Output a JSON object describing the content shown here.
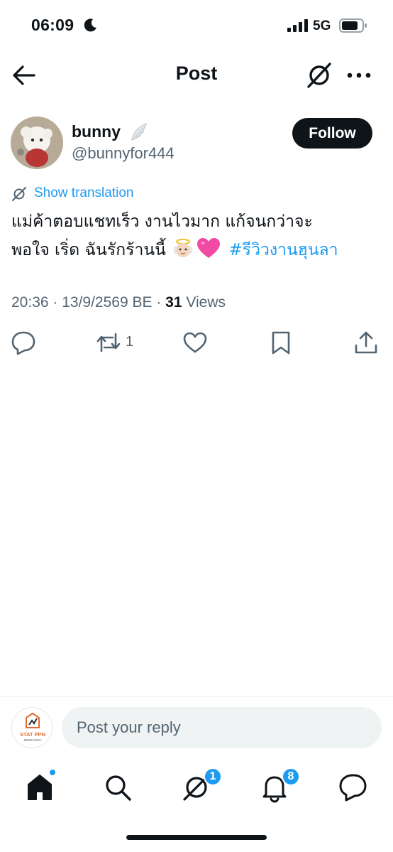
{
  "status_bar": {
    "time": "06:09",
    "network": "5G"
  },
  "header": {
    "title": "Post"
  },
  "post": {
    "author_name": "bunny",
    "author_handle": "@bunnyfor444",
    "follow_label": "Follow",
    "show_translation": "Show translation",
    "text_line1": "แม่ค้าตอบแชทเร็ว งานไวมาก แก้จนกว่าจะ",
    "text_line2": "พอใจ เริ่ด ฉันรักร้านนี้",
    "hashtag": "#รีวิวงานฮุนลา",
    "timestamp": "20:36 · 13/9/2569 BE · ",
    "views_count": "31",
    "views_label": " Views",
    "repost_count": "1"
  },
  "reply": {
    "placeholder": "Post your reply",
    "avatar_text": "STAT PPN",
    "avatar_subtext": "RESEARCH"
  },
  "tabbar": {
    "grok_badge": "1",
    "notifications_badge": "8"
  },
  "colors": {
    "accent": "#1d9bf0",
    "text": "#0f1419",
    "muted": "#536471",
    "input_bg": "#eff3f4"
  },
  "icons": [
    "back-arrow-icon",
    "grok-icon",
    "more-icon",
    "wing-icon",
    "translate-icon",
    "reply-icon",
    "repost-icon",
    "like-icon",
    "bookmark-icon",
    "share-icon",
    "home-icon",
    "search-icon",
    "notifications-icon",
    "messages-icon"
  ]
}
